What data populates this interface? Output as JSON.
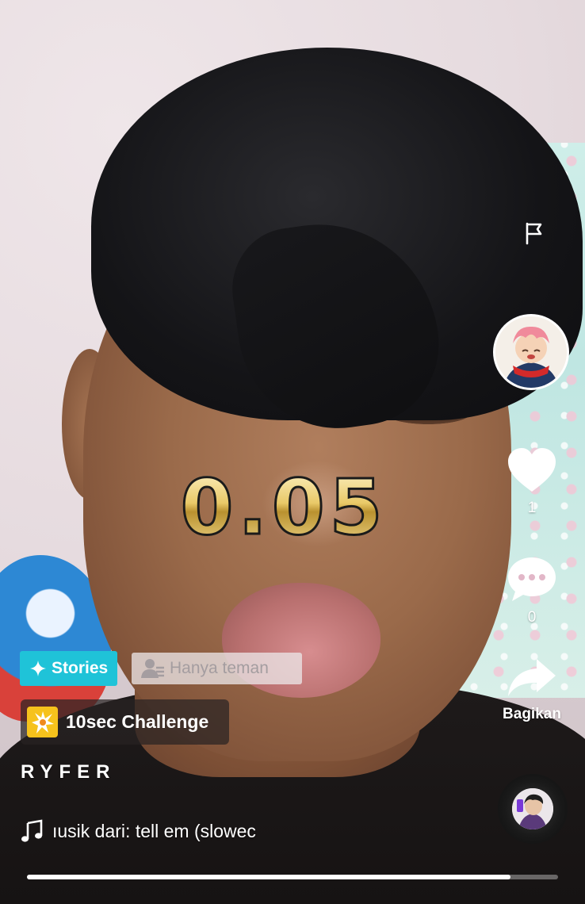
{
  "timer": {
    "text": "0.05"
  },
  "right_rail": {
    "report_icon": "flag-icon",
    "creator_avatar_icon": "anime-avatar-icon",
    "like": {
      "icon": "heart-icon",
      "count": "1"
    },
    "comment": {
      "icon": "comment-icon",
      "count": "0"
    },
    "share": {
      "icon": "share-arrow-icon",
      "label": "Bagikan"
    },
    "music_disc_icon": "music-disc-icon"
  },
  "badges": {
    "stories": {
      "icon": "sparkle-icon",
      "label": "Stories",
      "color": "#1fc3d8"
    },
    "privacy": {
      "icon": "friends-icon",
      "label": "Hanya teman"
    }
  },
  "challenge": {
    "icon": "burst-icon",
    "label": "10sec Challenge",
    "icon_color": "#f6c21c"
  },
  "author": {
    "username": "RYFER"
  },
  "music": {
    "icon": "music-note-icon",
    "text": "ıusik dari: tell em (slowec"
  },
  "playback": {
    "progress": 0.91
  }
}
